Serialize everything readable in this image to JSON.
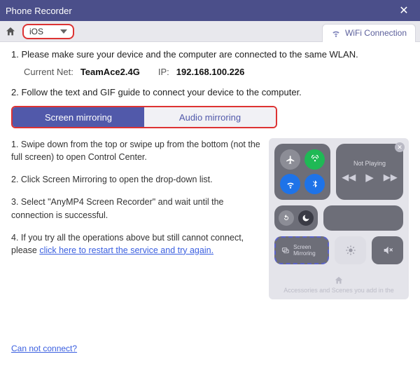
{
  "window": {
    "title": "Phone Recorder"
  },
  "toolbar": {
    "device_select": "iOS",
    "wifi_tab": "WiFi Connection"
  },
  "steps": {
    "one": "1. Please make sure your device and the computer are connected to the same WLAN.",
    "net_label": "Current Net:",
    "net_value": "TeamAce2.4G",
    "ip_label": "IP:",
    "ip_value": "192.168.100.226",
    "two": "2. Follow the text and GIF guide to connect your device to the computer."
  },
  "tabs": {
    "screen": "Screen mirroring",
    "audio": "Audio mirroring"
  },
  "instructions": {
    "i1": "1. Swipe down from the top or swipe up from the bottom (not the full screen) to open Control Center.",
    "i2": "2. Click Screen Mirroring to open the drop-down list.",
    "i3": "3. Select \"AnyMP4 Screen Recorder\" and wait until the connection is successful.",
    "i4_pre": "4. If you try all the operations above but still cannot connect, please ",
    "i4_link": "click here to restart the service and try again."
  },
  "control_center": {
    "not_playing": "Not Playing",
    "screen_mirroring": "Screen Mirroring",
    "acc_text": "Accessories and Scenes you add in the"
  },
  "footer": {
    "cannot_connect": "Can not connect?"
  }
}
